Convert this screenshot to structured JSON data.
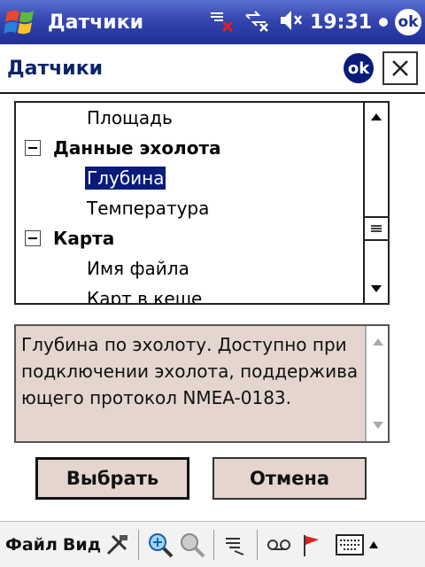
{
  "statusbar": {
    "app_title": "Датчики",
    "time": "19:31",
    "ok_label": "ok"
  },
  "dialog": {
    "title": "Датчики",
    "ok_label": "ok",
    "close_symbol": "✕"
  },
  "tree": {
    "rows": [
      {
        "label": "Площадь",
        "type": "item"
      },
      {
        "label": "Данные эхолота",
        "type": "group"
      },
      {
        "label": "Глубина",
        "type": "item",
        "selected": true
      },
      {
        "label": "Температура",
        "type": "item"
      },
      {
        "label": "Карта",
        "type": "group"
      },
      {
        "label": "Имя файла",
        "type": "item"
      },
      {
        "label": "Карт в кеше",
        "type": "item"
      }
    ]
  },
  "description": {
    "text": "Глубина по эхолоту. Доступно при подключении эхолота, поддерживающего протокол NMEA-0183."
  },
  "buttons": {
    "select_label": "Выбрать",
    "cancel_label": "Отмена"
  },
  "toolbar": {
    "file_label": "Файл",
    "view_label": "Вид"
  },
  "colors": {
    "title_bar": "#3546b0",
    "selection": "#0a1b7a",
    "panel_bg": "#e4d6ce"
  }
}
